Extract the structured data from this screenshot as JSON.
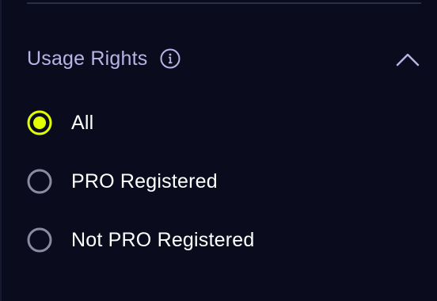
{
  "section": {
    "title": "Usage Rights",
    "info_icon": "info-icon",
    "collapse_icon": "chevron-up-icon"
  },
  "options": [
    {
      "label": "All",
      "selected": true
    },
    {
      "label": "PRO Registered",
      "selected": false
    },
    {
      "label": "Not PRO Registered",
      "selected": false
    }
  ],
  "colors": {
    "background": "#0a0c1e",
    "accent": "#e1ff00",
    "title_text": "#b9b3e6",
    "option_text": "#ffffff",
    "radio_unselected": "#8a8aa0"
  }
}
